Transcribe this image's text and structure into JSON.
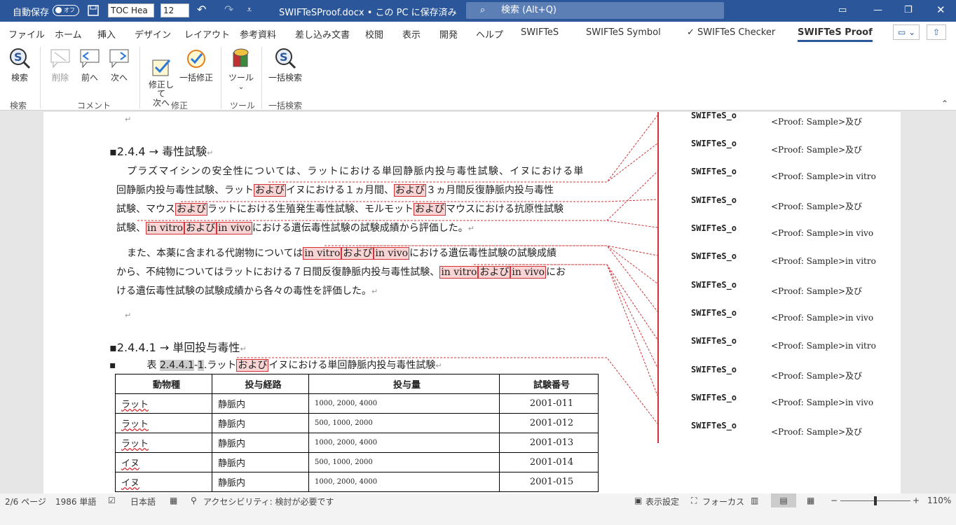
{
  "titlebar": {
    "autosave": "自動保存",
    "autosave_state": "オフ",
    "style_box": "TOC Hea",
    "size_box": "12",
    "doc_title": "SWIFTeSProof.docx • この PC に保存済み",
    "search_placeholder": "検索 (Alt+Q)"
  },
  "tabs": [
    "ファイル",
    "ホーム",
    "挿入",
    "デザイン",
    "レイアウト",
    "参考資料",
    "差し込み文書",
    "校閲",
    "表示",
    "開発",
    "ヘルプ",
    "SWIFTeS",
    "SWIFTeS Symbol",
    "✓ SWIFTeS Checker",
    "SWIFTeS Proof"
  ],
  "ribbon": {
    "search": "検索",
    "delete": "削除",
    "prev": "前へ",
    "next": "次へ",
    "fix_next": "修正して\n次へ",
    "fix_all": "一括修正",
    "tool": "ツール",
    "batch_search": "一括検索",
    "groups": {
      "search": "検索",
      "comment": "コメント",
      "fix": "修正",
      "tool": "ツール",
      "batch": "一括検索"
    }
  },
  "doc": {
    "h1": "2.4.4 → 毒性試験",
    "p1": [
      "プラズマイシンの安全性については、ラットにおける単回静脈内投与毒性試験、イヌにおける単",
      "回静脈内投与毒性試験、ラット",
      "および",
      "イヌにおける１ヵ月間、",
      "および",
      "３ヵ月間反復静脈内投与毒性",
      "試験、マウス",
      "および",
      "ラットにおける生殖発生毒性試験、モルモット",
      "および",
      "マウスにおける抗原性試験",
      "試験、",
      "in vitro",
      "および",
      "in vivo",
      "における遺伝毒性試験の試験成績から評価した。"
    ],
    "p2": [
      "また、本薬に含まれる代謝物については",
      "in vitro",
      "および",
      "in vivo",
      "における遺伝毒性試験の試験成績",
      "から、不純物についてはラットにおける７日間反復静脈内投与毒性試験、",
      "in vitro",
      "および",
      "in vivo",
      "にお",
      "ける遺伝毒性試験の試験成績から各々の毒性を評価した。"
    ],
    "h2": "2.4.4.1 → 単回投与毒性",
    "caption": [
      "表 ",
      "2.4.4.1",
      "-",
      "1",
      ".ラット",
      "および",
      "イヌにおける単回静脈内投与毒性試験"
    ],
    "table": {
      "headers": [
        "動物種",
        "投与経路",
        "投与量",
        "試験番号"
      ],
      "rows": [
        [
          "ラット",
          "静脈内",
          "1000, 2000, 4000",
          "2001-011"
        ],
        [
          "ラット",
          "静脈内",
          "500, 1000, 2000",
          "2001-012"
        ],
        [
          "ラット",
          "静脈内",
          "1000, 2000, 4000",
          "2001-013"
        ],
        [
          "イヌ",
          "静脈内",
          "500, 1000, 2000",
          "2001-014"
        ],
        [
          "イヌ",
          "静脈内",
          "1000, 2000, 4000",
          "2001-015"
        ]
      ]
    }
  },
  "comments": [
    {
      "author": "SWIFTeS_o",
      "text": "<Proof: Sample>及び"
    },
    {
      "author": "SWIFTeS_o",
      "text": "<Proof: Sample>及び"
    },
    {
      "author": "SWIFTeS_o",
      "text": "<Proof: Sample>in vitro"
    },
    {
      "author": "SWIFTeS_o",
      "text": "<Proof: Sample>及び"
    },
    {
      "author": "SWIFTeS_o",
      "text": "<Proof: Sample>in vivo"
    },
    {
      "author": "SWIFTeS_o",
      "text": "<Proof: Sample>in vitro"
    },
    {
      "author": "SWIFTeS_o",
      "text": "<Proof: Sample>及び"
    },
    {
      "author": "SWIFTeS_o",
      "text": "<Proof: Sample>in vivo"
    },
    {
      "author": "SWIFTeS_o",
      "text": "<Proof: Sample>in vitro"
    },
    {
      "author": "SWIFTeS_o",
      "text": "<Proof: Sample>及び"
    },
    {
      "author": "SWIFTeS_o",
      "text": "<Proof: Sample>in vivo"
    },
    {
      "author": "SWIFTeS_o",
      "text": "<Proof: Sample>及び"
    }
  ],
  "status": {
    "page": "2/6 ページ",
    "words": "1986 単語",
    "lang": "日本語",
    "access": "アクセシビリティ: 検討が必要です",
    "display": "表示設定",
    "focus": "フォーカス",
    "zoom": "110%"
  }
}
